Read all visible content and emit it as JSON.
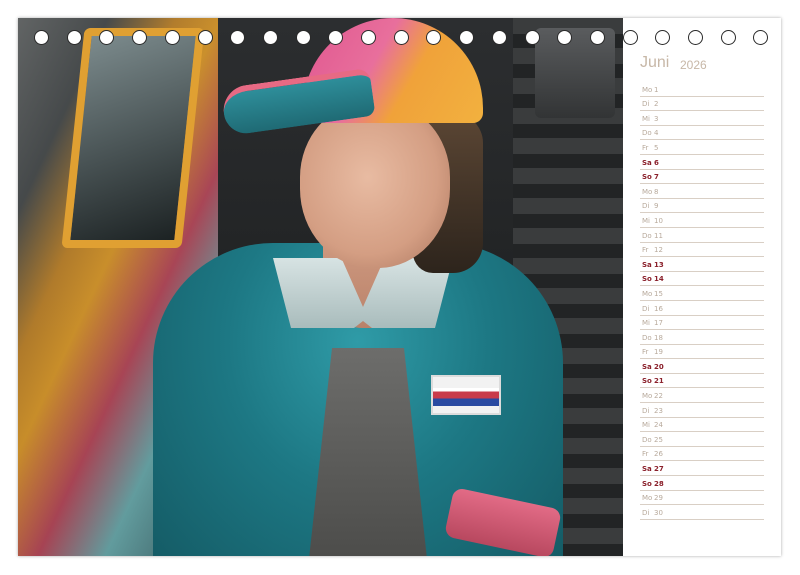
{
  "calendar": {
    "month": "Juni",
    "year": "2026",
    "days": [
      {
        "weekday": "Mo",
        "day": "1",
        "weekend": false
      },
      {
        "weekday": "Di",
        "day": "2",
        "weekend": false
      },
      {
        "weekday": "Mi",
        "day": "3",
        "weekend": false
      },
      {
        "weekday": "Do",
        "day": "4",
        "weekend": false
      },
      {
        "weekday": "Fr",
        "day": "5",
        "weekend": false
      },
      {
        "weekday": "Sa",
        "day": "6",
        "weekend": true
      },
      {
        "weekday": "So",
        "day": "7",
        "weekend": true
      },
      {
        "weekday": "Mo",
        "day": "8",
        "weekend": false
      },
      {
        "weekday": "Di",
        "day": "9",
        "weekend": false
      },
      {
        "weekday": "Mi",
        "day": "10",
        "weekend": false
      },
      {
        "weekday": "Do",
        "day": "11",
        "weekend": false
      },
      {
        "weekday": "Fr",
        "day": "12",
        "weekend": false
      },
      {
        "weekday": "Sa",
        "day": "13",
        "weekend": true
      },
      {
        "weekday": "So",
        "day": "14",
        "weekend": true
      },
      {
        "weekday": "Mo",
        "day": "15",
        "weekend": false
      },
      {
        "weekday": "Di",
        "day": "16",
        "weekend": false
      },
      {
        "weekday": "Mi",
        "day": "17",
        "weekend": false
      },
      {
        "weekday": "Do",
        "day": "18",
        "weekend": false
      },
      {
        "weekday": "Fr",
        "day": "19",
        "weekend": false
      },
      {
        "weekday": "Sa",
        "day": "20",
        "weekend": true
      },
      {
        "weekday": "So",
        "day": "21",
        "weekend": true
      },
      {
        "weekday": "Mo",
        "day": "22",
        "weekend": false
      },
      {
        "weekday": "Di",
        "day": "23",
        "weekend": false
      },
      {
        "weekday": "Mi",
        "day": "24",
        "weekend": false
      },
      {
        "weekday": "Do",
        "day": "25",
        "weekend": false
      },
      {
        "weekday": "Fr",
        "day": "26",
        "weekend": false
      },
      {
        "weekday": "Sa",
        "day": "27",
        "weekend": true
      },
      {
        "weekday": "So",
        "day": "28",
        "weekend": true
      },
      {
        "weekday": "Mo",
        "day": "29",
        "weekend": false
      },
      {
        "weekday": "Di",
        "day": "30",
        "weekend": false
      }
    ]
  },
  "colors": {
    "weekend_text": "#8a1f2a",
    "weekday_text": "#b8aa9c",
    "month_title": "#c7b7a7",
    "rule_line": "#d9cfc5"
  },
  "binding": {
    "hole_count": 23
  }
}
